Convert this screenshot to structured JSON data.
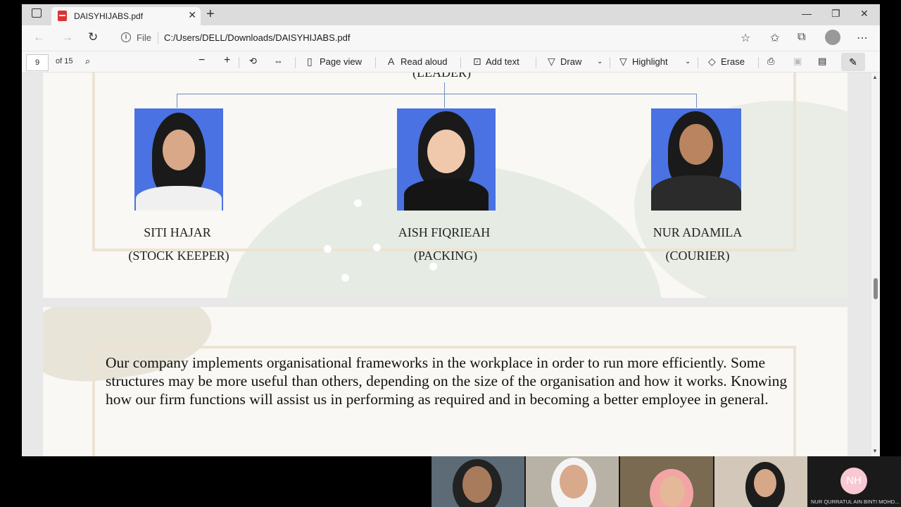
{
  "tab": {
    "title": "DAISYHIJABS.pdf"
  },
  "address": {
    "scheme_label": "File",
    "url": "C:/Users/DELL/Downloads/DAISYHIJABS.pdf"
  },
  "pdf_toolbar": {
    "page_number": "9",
    "page_count": "of 15",
    "page_view": "Page view",
    "read_aloud": "Read aloud",
    "add_text": "Add text",
    "draw": "Draw",
    "highlight": "Highlight",
    "erase": "Erase"
  },
  "document": {
    "leader_label": "(LEADER)",
    "members": [
      {
        "name": "SITI HAJAR",
        "role": "(STOCK KEEPER)"
      },
      {
        "name": "AISH FIQRIEAH",
        "role": "(PACKING)"
      },
      {
        "name": "NUR ADAMILA",
        "role": "(COURIER)"
      }
    ],
    "paragraph": "Our company implements organisational frameworks in the workplace in order to run more efficiently. Some structures may be more useful than others, depending on the size of the organisation and how it works. Knowing how our firm functions will assist us in performing as required and in becoming a better employee in general."
  },
  "meeting": {
    "initials": "NH",
    "participant_name": "NUR QURRATUL AIN BINTI MOHD..."
  },
  "colors": {
    "photo_bg": "#4a72e3",
    "connector": "#6f8ebf",
    "page_bg": "#f9f8f4"
  }
}
